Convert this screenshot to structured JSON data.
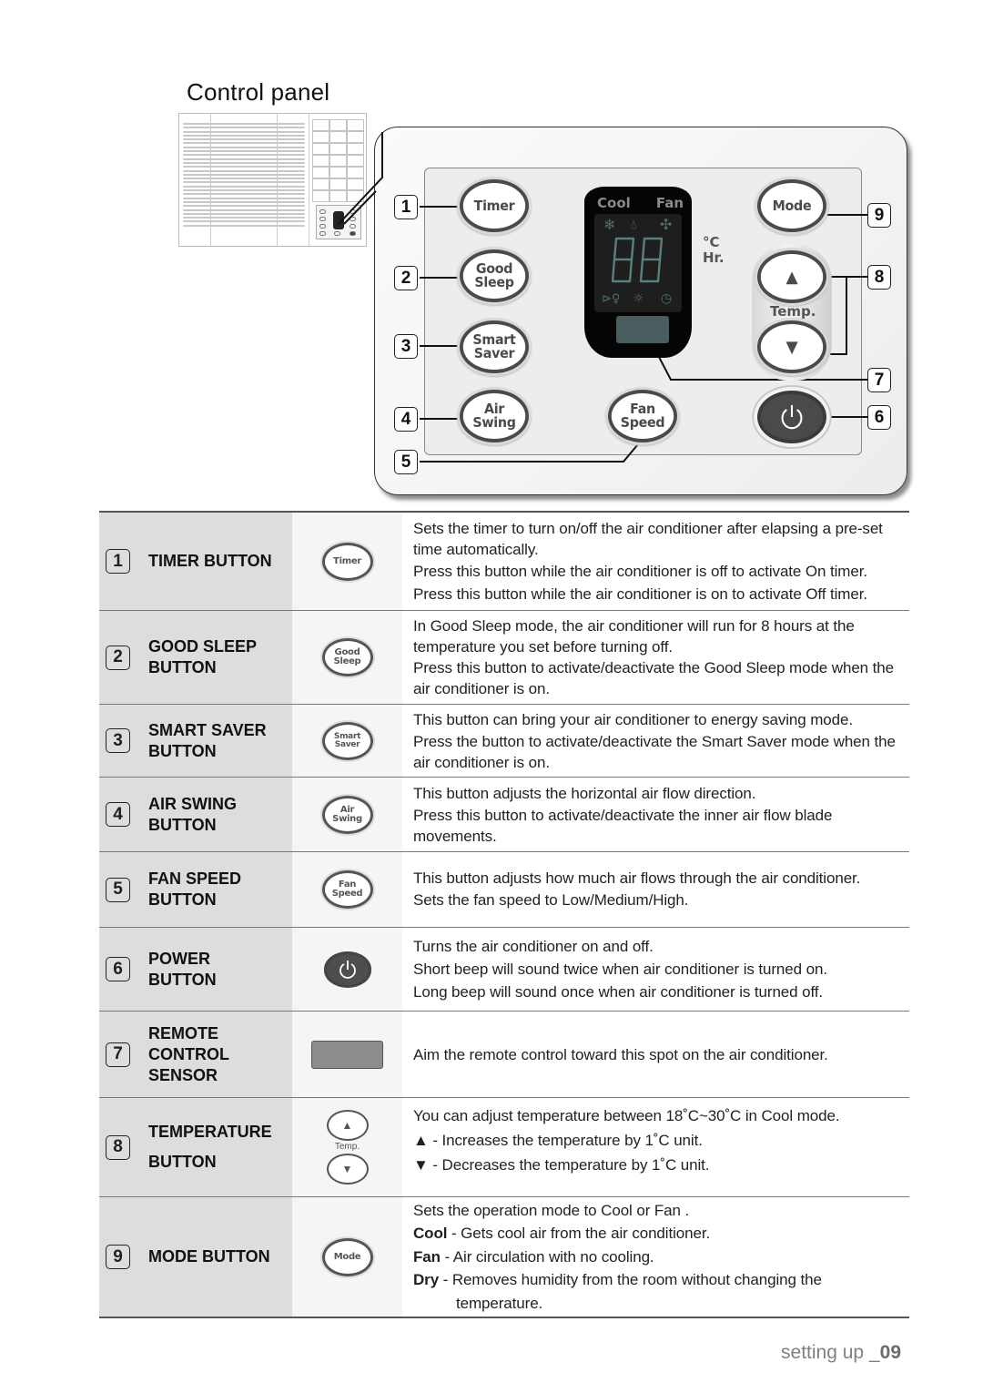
{
  "page": {
    "title": "Control panel",
    "footer_section": "setting up _",
    "footer_page": "09"
  },
  "panel": {
    "buttons": {
      "timer": [
        "Timer"
      ],
      "good_sleep": [
        "Good",
        "Sleep"
      ],
      "smart_saver": [
        "Smart",
        "Saver"
      ],
      "air_swing": [
        "Air",
        "Swing"
      ],
      "fan_speed": [
        "Fan",
        "Speed"
      ],
      "mode": [
        "Mode"
      ],
      "temp_up": "▲",
      "temp_down": "▼",
      "power": "power-icon"
    },
    "temp_label": "Temp.",
    "lcd": {
      "mode_left": "Cool",
      "mode_right": "Fan",
      "digits": "88",
      "unit_celsius": "°C",
      "unit_hours": "Hr.",
      "top_icons": [
        "snowflake-icon",
        "dry-drop-icon",
        "fan-icon"
      ],
      "bottom_icons": [
        "sleep-icon",
        "smart-saver-icon",
        "timer-clock-icon"
      ]
    },
    "callouts": [
      "1",
      "2",
      "3",
      "4",
      "5",
      "6",
      "7",
      "8",
      "9"
    ]
  },
  "table": {
    "rows": [
      {
        "num": "1",
        "name": [
          "TIMER BUTTON"
        ],
        "icon": "timer-button-icon",
        "icon_label": [
          "Timer"
        ],
        "desc": [
          "Sets the timer to turn on/off the air conditioner after elapsing a pre-set time automatically.",
          "Press this button while the air conditioner is off to activate On timer.",
          "Press this button while the air conditioner is on to activate Off timer."
        ]
      },
      {
        "num": "2",
        "name": [
          "GOOD SLEEP",
          "BUTTON"
        ],
        "icon": "good-sleep-button-icon",
        "icon_label": [
          "Good",
          "Sleep"
        ],
        "desc": [
          "In Good Sleep mode, the air conditioner will run for 8 hours at the temperature you set before turning off.",
          "Press this button to activate/deactivate the Good Sleep mode when the air conditioner is on."
        ]
      },
      {
        "num": "3",
        "name": [
          "SMART SAVER",
          "BUTTON"
        ],
        "icon": "smart-saver-button-icon",
        "icon_label": [
          "Smart",
          "Saver"
        ],
        "desc": [
          "This button can bring your air conditioner to energy saving mode.",
          "Press the button to activate/deactivate the Smart Saver mode when the air conditioner is on."
        ]
      },
      {
        "num": "4",
        "name": [
          "AIR SWING",
          "BUTTON"
        ],
        "icon": "air-swing-button-icon",
        "icon_label": [
          "Air",
          "Swing"
        ],
        "desc": [
          "This button adjusts the horizontal air flow direction.",
          "Press this button to activate/deactivate the inner air flow blade movements."
        ]
      },
      {
        "num": "5",
        "name": [
          "FAN SPEED",
          "BUTTON"
        ],
        "icon": "fan-speed-button-icon",
        "icon_label": [
          "Fan",
          "Speed"
        ],
        "desc": [
          "This button adjusts how much air flows through the air conditioner.",
          "Sets the fan speed to Low/Medium/High."
        ]
      },
      {
        "num": "6",
        "name": [
          "POWER",
          "BUTTON"
        ],
        "icon": "power-button-icon",
        "icon_label": [],
        "desc": [
          "Turns the air conditioner on and off.",
          "Short beep will sound twice when air conditioner is turned on.",
          "Long beep will sound once when air conditioner is turned off."
        ]
      },
      {
        "num": "7",
        "name": [
          "REMOTE",
          "CONTROL",
          "SENSOR"
        ],
        "icon": "remote-sensor-icon",
        "icon_label": [],
        "desc": [
          "Aim the remote control toward this spot on the air conditioner."
        ]
      },
      {
        "num": "8",
        "name": [
          "TEMPERATURE",
          "BUTTON"
        ],
        "icon": "temperature-buttons-icon",
        "icon_label": [
          "▲",
          "Temp.",
          "▼"
        ],
        "desc": [
          "You can adjust temperature between 18˚C~30˚C in Cool mode.",
          "▲ - Increases the temperature by 1˚C unit.",
          "▼ - Decreases the temperature by 1˚C unit."
        ]
      },
      {
        "num": "9",
        "name": [
          "MODE BUTTON"
        ],
        "icon": "mode-button-icon",
        "icon_label": [
          "Mode"
        ],
        "desc_intro": "Sets the operation mode to Cool or Fan .",
        "modes": [
          {
            "term": "Cool",
            "text": " - Gets cool air from the air conditioner."
          },
          {
            "term": "Fan",
            "text": " - Air circulation with no cooling."
          },
          {
            "term": "Dry",
            "text": " - Removes humidity from the room without changing the"
          }
        ],
        "desc_tail": "temperature."
      }
    ]
  }
}
